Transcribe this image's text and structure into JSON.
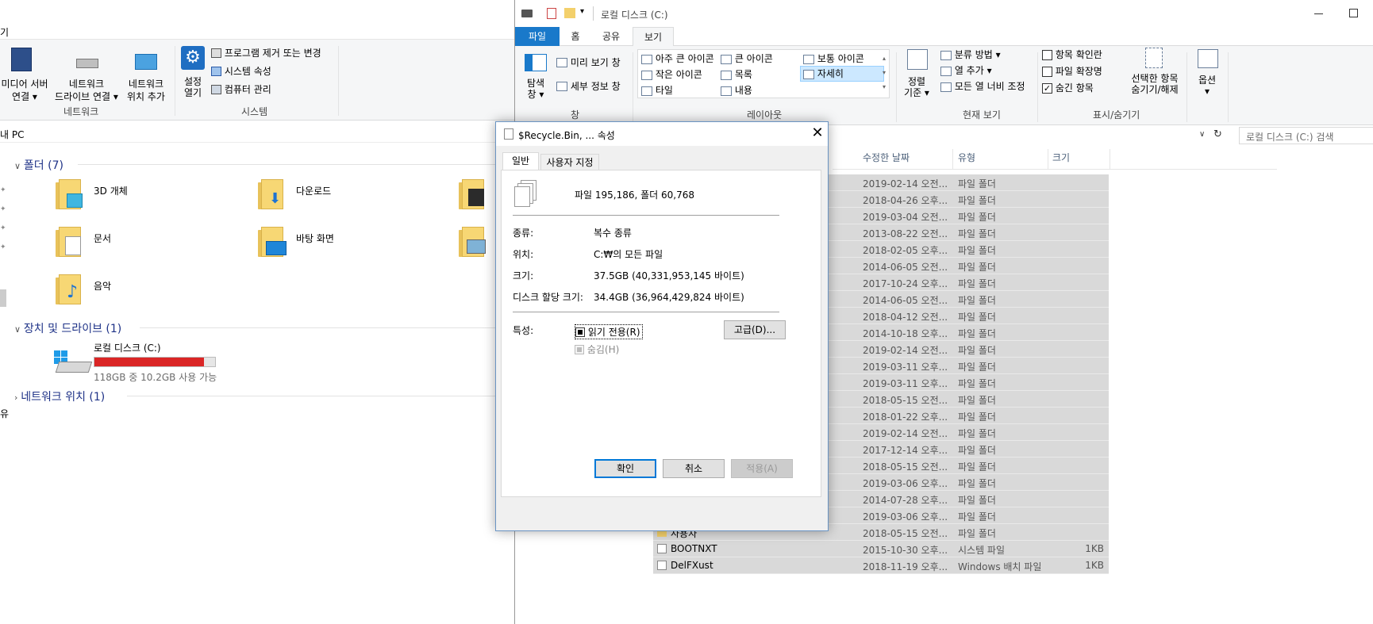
{
  "left": {
    "ribbon": {
      "media_server": "미디어 서버\n연결 ▾",
      "map_drive": "네트워크\n드라이브 연결 ▾",
      "add_location": "네트워크\n위치 추가",
      "group_network": "네트워크",
      "settings": "설정\n열기",
      "uninstall": "프로그램 제거 또는 변경",
      "sys_props": "시스템 속성",
      "manage": "컴퓨터 관리",
      "group_system": "시스템"
    },
    "title_fragment": "기",
    "address": "내 PC",
    "folders_header": "폴더 (7)",
    "folders": [
      "3D 개체",
      "다운로드",
      "문서",
      "바탕 화면",
      "음악"
    ],
    "devices_header": "장치 및 드라이브 (1)",
    "drive": {
      "name": "로컬 디스크 (C:)",
      "space": "118GB 중 10.2GB 사용 가능",
      "used_fraction": 0.91
    },
    "network_header": "네트워크 위치 (1)",
    "side_fragment": "유"
  },
  "right": {
    "title": "로컬 디스크 (C:)",
    "tabs": [
      "파일",
      "홈",
      "공유",
      "보기"
    ],
    "pane": {
      "nav": "탐색\n창 ▾",
      "preview": "미리 보기 창",
      "details": "세부 정보 창",
      "group": "창"
    },
    "layout": {
      "items": [
        "아주 큰 아이콘",
        "큰 아이콘",
        "보통 아이콘",
        "작은 아이콘",
        "목록",
        "자세히",
        "타일",
        "내용"
      ],
      "group": "레이아웃"
    },
    "current_view": {
      "sort": "정렬\n기준 ▾",
      "group_by": "분류 방법 ▾",
      "add_col": "열 추가 ▾",
      "fit": "모든 열 너비 조정",
      "group": "현재 보기"
    },
    "showhide": {
      "item_cb": "항목 확인란",
      "ext": "파일 확장명",
      "hidden": "숨긴 항목",
      "hide_sel": "선택한 항목\n숨기기/해제",
      "group": "표시/숨기기"
    },
    "options": "옵션\n▾",
    "search_placeholder": "로컬 디스크 (C:) 검색",
    "columns": [
      "수정한 날짜",
      "유형",
      "크기"
    ],
    "rows": [
      {
        "name": "",
        "date": "2019-02-14 오전...",
        "type": "파일 폴더",
        "size": ""
      },
      {
        "name": "",
        "date": "2018-04-26 오후...",
        "type": "파일 폴더",
        "size": ""
      },
      {
        "name": "",
        "date": "2019-03-04 오전...",
        "type": "파일 폴더",
        "size": ""
      },
      {
        "name": "",
        "date": "2013-08-22 오전...",
        "type": "파일 폴더",
        "size": ""
      },
      {
        "name": "",
        "date": "2018-02-05 오후...",
        "type": "파일 폴더",
        "size": ""
      },
      {
        "name": "",
        "date": "2014-06-05 오전...",
        "type": "파일 폴더",
        "size": ""
      },
      {
        "name": "",
        "date": "2017-10-24 오후...",
        "type": "파일 폴더",
        "size": ""
      },
      {
        "name": "",
        "date": "2014-06-05 오전...",
        "type": "파일 폴더",
        "size": ""
      },
      {
        "name": "",
        "date": "2018-04-12 오전...",
        "type": "파일 폴더",
        "size": ""
      },
      {
        "name": "",
        "date": "2014-10-18 오후...",
        "type": "파일 폴더",
        "size": ""
      },
      {
        "name": "",
        "date": "2019-02-14 오전...",
        "type": "파일 폴더",
        "size": ""
      },
      {
        "name": "",
        "date": "2019-03-11 오후...",
        "type": "파일 폴더",
        "size": ""
      },
      {
        "name": "",
        "date": "2019-03-11 오후...",
        "type": "파일 폴더",
        "size": ""
      },
      {
        "name": "",
        "date": "2018-05-15 오전...",
        "type": "파일 폴더",
        "size": ""
      },
      {
        "name": "",
        "date": "2018-01-22 오후...",
        "type": "파일 폴더",
        "size": ""
      },
      {
        "name": "",
        "date": "2019-02-14 오전...",
        "type": "파일 폴더",
        "size": ""
      },
      {
        "name": "",
        "date": "2017-12-14 오후...",
        "type": "파일 폴더",
        "size": ""
      },
      {
        "name": "",
        "date": "2018-05-15 오전...",
        "type": "파일 폴더",
        "size": ""
      },
      {
        "name": "",
        "date": "2019-03-06 오후...",
        "type": "파일 폴더",
        "size": ""
      },
      {
        "name": "",
        "date": "2014-07-28 오후...",
        "type": "파일 폴더",
        "size": ""
      },
      {
        "name": "",
        "date": "2019-03-06 오후...",
        "type": "파일 폴더",
        "size": ""
      },
      {
        "name": "사용자",
        "date": "2018-05-15 오전...",
        "type": "파일 폴더",
        "size": ""
      },
      {
        "name": "BOOTNXT",
        "date": "2015-10-30 오후...",
        "type": "시스템 파일",
        "size": "1KB"
      },
      {
        "name": "DelFXust",
        "date": "2018-11-19 오후...",
        "type": "Windows 배치 파일",
        "size": "1KB"
      }
    ]
  },
  "dialog": {
    "title": "$Recycle.Bin, ... 속성",
    "tabs": [
      "일반",
      "사용자 지정"
    ],
    "summary": "파일 195,186, 폴더 60,768",
    "type_label": "종류:",
    "type_value": "복수 종류",
    "loc_label": "위치:",
    "loc_value": "C:₩의 모든 파일",
    "size_label": "크기:",
    "size_value": "37.5GB (40,331,953,145 바이트)",
    "disk_label": "디스크 할당 크기:",
    "disk_value": "34.4GB (36,964,429,824 바이트)",
    "attr_label": "특성:",
    "readonly": "읽기 전용(R)",
    "hidden": "숨김(H)",
    "advanced": "고급(D)...",
    "ok": "확인",
    "cancel": "취소",
    "apply": "적용(A)"
  },
  "colors": {
    "accent": "#1979ca",
    "drive_bar": "#da2626",
    "selection": "#d9d9d9"
  }
}
